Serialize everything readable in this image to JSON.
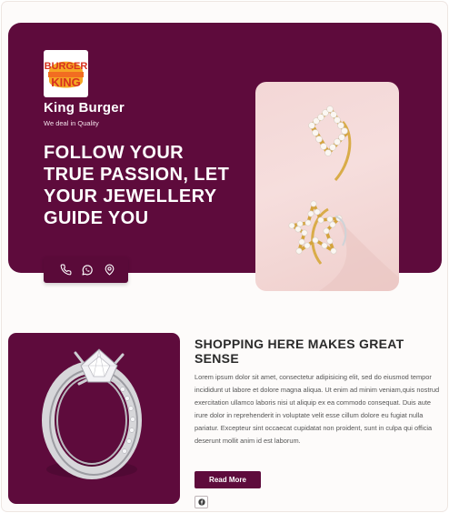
{
  "brand": {
    "logo_text_top": "BURGER",
    "logo_text_bottom": "KING",
    "name": "King Burger",
    "tagline": "We deal in Quality"
  },
  "hero": {
    "headline": "FOLLOW YOUR TRUE PASSION, LET YOUR JEWELLERY GUIDE YOU",
    "contact_icons": [
      "phone-icon",
      "whatsapp-icon",
      "map-pin-icon"
    ]
  },
  "feature": {
    "title": "SHOPPING HERE MAKES GREAT SENSE",
    "body": "Lorem ipsum dolor sit amet, consectetur adipisicing elit, sed do eiusmod tempor incididunt ut labore et dolore magna aliqua. Ut enim ad minim veniam,quis nostrud exercitation ullamco laboris nisi ut aliquip ex ea commodo consequat. Duis aute irure dolor in reprehenderit in voluptate velit esse cillum dolore eu fugiat nulla pariatur. Excepteur sint occaecat cupidatat non proident, sunt in culpa qui officia deserunt mollit anim id est laborum.",
    "button_label": "Read More",
    "social_icon": "facebook-icon"
  },
  "colors": {
    "brand_purple": "#5e0b3c",
    "logo_orange": "#f26d21",
    "logo_bun": "#f5a524",
    "logo_red": "#d7301f"
  }
}
